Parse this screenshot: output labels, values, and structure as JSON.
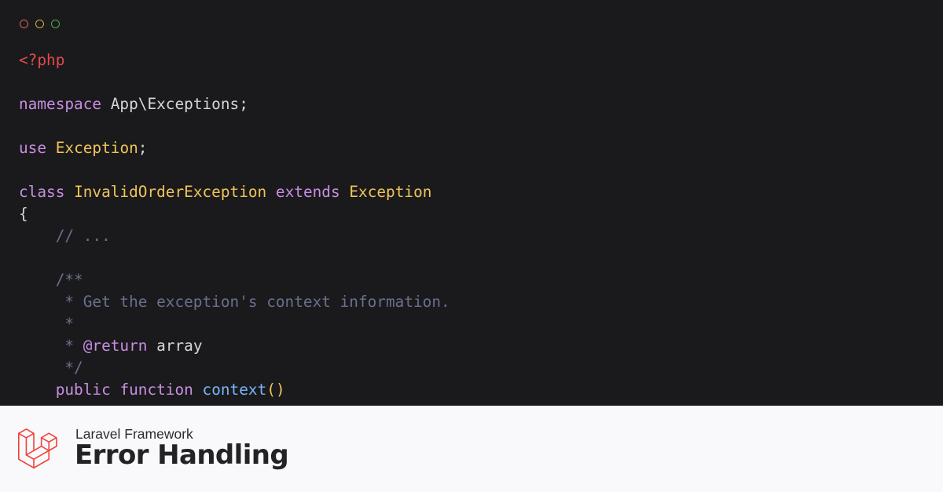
{
  "window": {
    "controls": [
      {
        "name": "close",
        "color": "#d9634e"
      },
      {
        "name": "minimize",
        "color": "#d9a93e"
      },
      {
        "name": "maximize",
        "color": "#4fae4b"
      }
    ]
  },
  "theme": {
    "background": "#1a1a1c",
    "plain": "#d7d7d9",
    "keyword": "#c98ee3",
    "class_name": "#f1c45a",
    "php_tag": "#e5484d",
    "comment": "#6a6f8e",
    "doc_keyword": "#c98ee3",
    "function_name": "#7bb5ff",
    "bracket": "#f1c45a"
  },
  "code": {
    "lines": [
      [
        {
          "t": "<?php",
          "k": "php_tag"
        }
      ],
      [],
      [
        {
          "t": "namespace",
          "k": "keyword"
        },
        {
          "t": " App\\Exceptions;",
          "k": "plain"
        }
      ],
      [],
      [
        {
          "t": "use",
          "k": "keyword"
        },
        {
          "t": " ",
          "k": "plain"
        },
        {
          "t": "Exception",
          "k": "class_name"
        },
        {
          "t": ";",
          "k": "plain"
        }
      ],
      [],
      [
        {
          "t": "class",
          "k": "keyword"
        },
        {
          "t": " ",
          "k": "plain"
        },
        {
          "t": "InvalidOrderException",
          "k": "class_name"
        },
        {
          "t": " ",
          "k": "plain"
        },
        {
          "t": "extends",
          "k": "keyword"
        },
        {
          "t": " ",
          "k": "plain"
        },
        {
          "t": "Exception",
          "k": "class_name"
        }
      ],
      [
        {
          "t": "{",
          "k": "plain"
        }
      ],
      [
        {
          "t": "    // ...",
          "k": "comment"
        }
      ],
      [],
      [
        {
          "t": "    /**",
          "k": "comment"
        }
      ],
      [
        {
          "t": "     * Get the exception's context information.",
          "k": "comment"
        }
      ],
      [
        {
          "t": "     *",
          "k": "comment"
        }
      ],
      [
        {
          "t": "     * ",
          "k": "comment"
        },
        {
          "t": "@return",
          "k": "doc_keyword"
        },
        {
          "t": " array",
          "k": "plain"
        }
      ],
      [
        {
          "t": "     */",
          "k": "comment"
        }
      ],
      [
        {
          "t": "    ",
          "k": "plain"
        },
        {
          "t": "public",
          "k": "keyword"
        },
        {
          "t": " ",
          "k": "plain"
        },
        {
          "t": "function",
          "k": "keyword"
        },
        {
          "t": " ",
          "k": "plain"
        },
        {
          "t": "context",
          "k": "function_name"
        },
        {
          "t": "()",
          "k": "bracket"
        }
      ]
    ]
  },
  "footer": {
    "logo_icon": "laravel-logo",
    "logo_color": "#f1423a",
    "subtitle": "Laravel Framework",
    "title": "Error Handling"
  }
}
